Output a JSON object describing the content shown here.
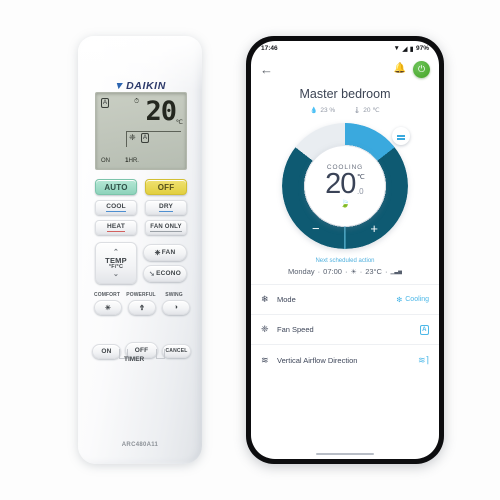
{
  "remote": {
    "brand": "DAIKIN",
    "brand_mark": "▼",
    "model": "ARC480A11",
    "lcd": {
      "auto_badge": "A",
      "clock_icon": "⏱",
      "temperature": "20",
      "unit": "℃",
      "fan_icon": "❈",
      "fan_auto_badge": "A",
      "timer_icon": "⏱",
      "on_label": "ON",
      "hours_value": "1",
      "hours_label": "HR."
    },
    "buttons": {
      "auto": "AUTO",
      "off": "OFF",
      "cool": "COOL",
      "dry": "DRY",
      "heat": "HEAT",
      "fan_only": "FAN ONLY",
      "temp_label": "TEMP",
      "temp_units": "°F/°C",
      "temp_up": "⌃",
      "temp_down": "⌄",
      "fan": "FAN",
      "fan_icon": "❈",
      "econo": "ECONO",
      "econo_icon": "➘",
      "comfort_label": "COMFORT",
      "comfort_icon": "☀",
      "powerful_label": "POWERFUL",
      "powerful_icon": "⇮",
      "swing_label": "SWING",
      "swing_icon": "◑",
      "timer_on": "ON",
      "timer_off": "OFF",
      "timer_cancel": "CANCEL",
      "timer_word": "TIMER"
    }
  },
  "phone": {
    "status": {
      "time": "17:46",
      "wifi_icon": "▼",
      "signal_icon": "◢",
      "battery_icon": "▮",
      "battery_level": "97%"
    },
    "appbar": {
      "back_icon": "←",
      "bell_icon": "🔔",
      "power_icon": "⏻"
    },
    "title": "Master bedroom",
    "stats": [
      {
        "icon": "💧",
        "value": "23 %"
      },
      {
        "icon": "🌡",
        "value": "20 ℃"
      }
    ],
    "dial": {
      "mode_label": "COOLING",
      "temperature": "20",
      "unit": "℃",
      "decimal": ".0",
      "eco_icon": "🍃",
      "minus": "−",
      "plus": "+",
      "menu_icon": "menu"
    },
    "schedule": {
      "title": "Next scheduled action",
      "day": "Monday",
      "sep1": "·",
      "time": "07:00",
      "sep2": "·",
      "mode_icon": "☀",
      "sep3": "·",
      "temperature": "23°C",
      "sep4": "·",
      "fan_icon": "▁▃▅"
    },
    "rows": [
      {
        "icon": "❄",
        "name": "Mode",
        "value": "Cooling",
        "value_icon": "❇",
        "badge": ""
      },
      {
        "icon": "❈",
        "name": "Fan Speed",
        "value": "",
        "value_icon": "",
        "badge": "A"
      },
      {
        "icon": "≋",
        "name": "Vertical Airflow Direction",
        "value": "",
        "value_icon": "≋⌉",
        "badge": ""
      }
    ]
  },
  "colors": {
    "auto_green": "#8ed3bb",
    "off_yellow": "#e2cf3f",
    "dial_light_blue": "#3aa9de",
    "dial_dark_teal": "#0e5a72",
    "accent_blue": "#4db8e8",
    "power_green": "#43a325"
  }
}
